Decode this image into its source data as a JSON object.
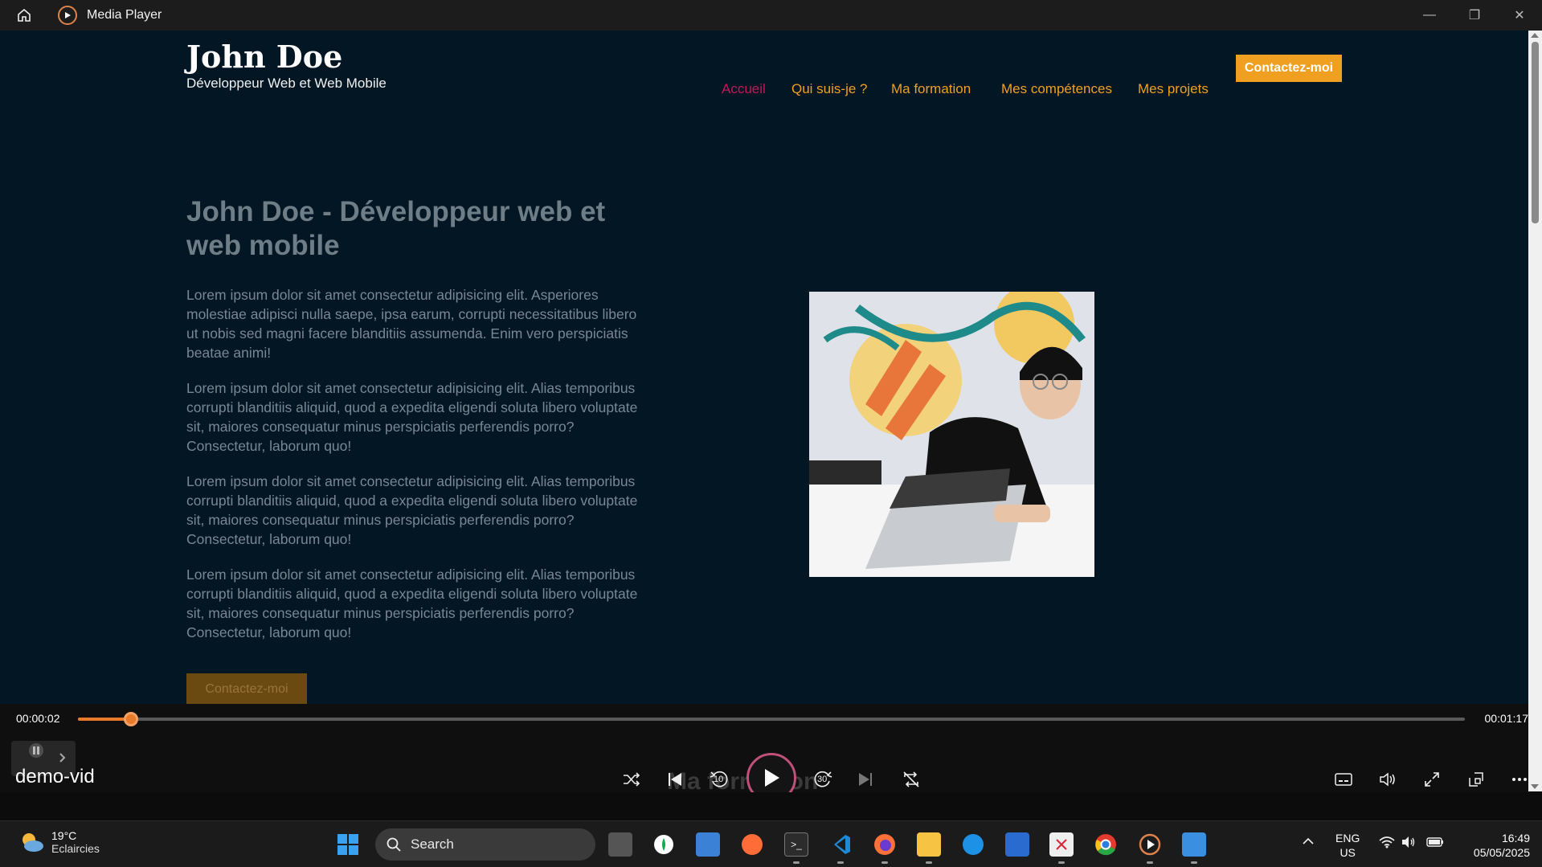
{
  "window": {
    "title": "Media Player"
  },
  "site": {
    "name": "John Doe",
    "subtitle": "Développeur Web et Web Mobile",
    "nav": [
      "Accueil",
      "Qui suis-je ?",
      "Ma formation",
      "Mes compétences",
      "Mes projets"
    ],
    "nav_cta": "Contactez-moi",
    "hero_title": "John Doe - Développeur web et web mobile",
    "paragraphs": [
      "Lorem ipsum dolor sit amet consectetur adipisicing elit. Asperiores molestiae adipisci nulla saepe, ipsa earum, corrupti necessitatibus libero ut nobis sed magni facere blanditiis assumenda. Enim vero perspiciatis beatae animi!",
      "Lorem ipsum dolor sit amet consectetur adipisicing elit. Alias temporibus corrupti blanditiis aliquid, quod a expedita eligendi soluta libero voluptate sit, maiores consequatur minus perspiciatis perferendis porro? Consectetur, laborum quo!",
      "Lorem ipsum dolor sit amet consectetur adipisicing elit. Alias temporibus corrupti blanditiis aliquid, quod a expedita eligendi soluta libero voluptate sit, maiores consequatur minus perspiciatis perferendis porro? Consectetur, laborum quo!",
      "Lorem ipsum dolor sit amet consectetur adipisicing elit. Alias temporibus corrupti blanditiis aliquid, quod a expedita eligendi soluta libero voluptate sit, maiores consequatur minus perspiciatis perferendis porro? Consectetur, laborum quo!"
    ],
    "hero_cta": "Contactez-moi"
  },
  "player": {
    "current_time": "00:00:02",
    "total_time": "00:01:17",
    "progress": 0.038,
    "video_title": "demo-vid",
    "overlay_text": "Ma formation",
    "skip_back": "10",
    "skip_forward": "30"
  },
  "taskbar": {
    "temperature": "19°C",
    "weather": "Eclaircies",
    "search_placeholder": "Search",
    "lang": "ENG",
    "region": "US",
    "time": "16:49",
    "date": "05/05/2025"
  },
  "colors": {
    "accent": "#e87a2a",
    "nav_active": "#c2185b",
    "nav": "#f0a020",
    "page_bg": "#021624"
  }
}
